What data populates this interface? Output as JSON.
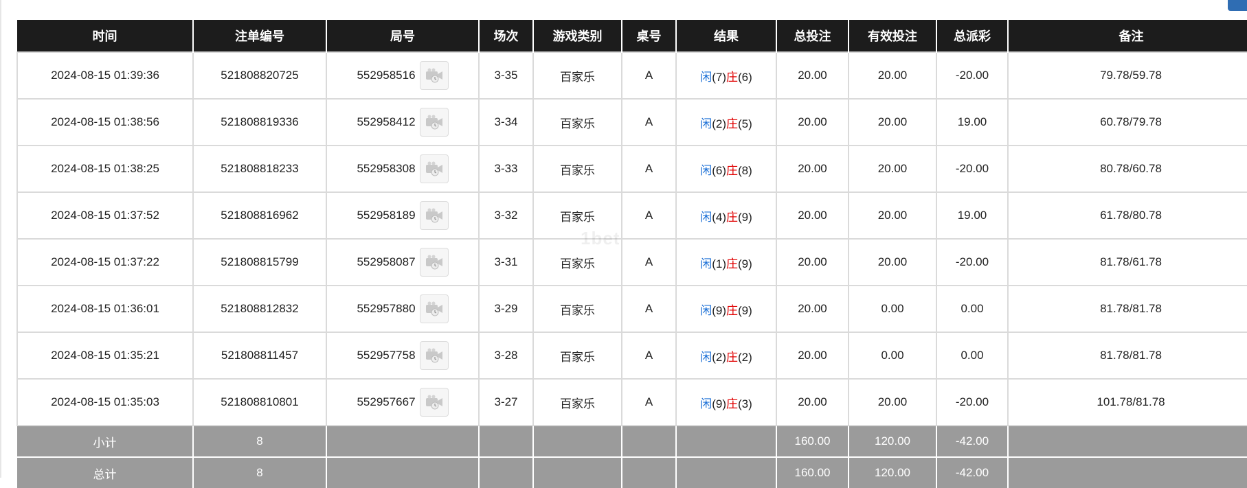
{
  "headers": [
    "时间",
    "注单编号",
    "局号",
    "场次",
    "游戏类别",
    "桌号",
    "结果",
    "总投注",
    "有效投注",
    "总派彩",
    "备注"
  ],
  "result_labels": {
    "player": "闲",
    "banker": "庄"
  },
  "rows": [
    {
      "time": "2024-08-15 01:39:36",
      "bet_id": "521808820725",
      "round": "552958516",
      "session": "3-35",
      "game": "百家乐",
      "table": "A",
      "player": "(7)",
      "banker": "(6)",
      "total_bet": "20.00",
      "valid_bet": "20.00",
      "payout": "-20.00",
      "note": "79.78/59.78"
    },
    {
      "time": "2024-08-15 01:38:56",
      "bet_id": "521808819336",
      "round": "552958412",
      "session": "3-34",
      "game": "百家乐",
      "table": "A",
      "player": "(2)",
      "banker": "(5)",
      "total_bet": "20.00",
      "valid_bet": "20.00",
      "payout": "19.00",
      "note": "60.78/79.78"
    },
    {
      "time": "2024-08-15 01:38:25",
      "bet_id": "521808818233",
      "round": "552958308",
      "session": "3-33",
      "game": "百家乐",
      "table": "A",
      "player": "(6)",
      "banker": "(8)",
      "total_bet": "20.00",
      "valid_bet": "20.00",
      "payout": "-20.00",
      "note": "80.78/60.78"
    },
    {
      "time": "2024-08-15 01:37:52",
      "bet_id": "521808816962",
      "round": "552958189",
      "session": "3-32",
      "game": "百家乐",
      "table": "A",
      "player": "(4)",
      "banker": "(9)",
      "total_bet": "20.00",
      "valid_bet": "20.00",
      "payout": "19.00",
      "note": "61.78/80.78"
    },
    {
      "time": "2024-08-15 01:37:22",
      "bet_id": "521808815799",
      "round": "552958087",
      "session": "3-31",
      "game": "百家乐",
      "table": "A",
      "player": "(1)",
      "banker": "(9)",
      "total_bet": "20.00",
      "valid_bet": "20.00",
      "payout": "-20.00",
      "note": "81.78/61.78"
    },
    {
      "time": "2024-08-15 01:36:01",
      "bet_id": "521808812832",
      "round": "552957880",
      "session": "3-29",
      "game": "百家乐",
      "table": "A",
      "player": "(9)",
      "banker": "(9)",
      "total_bet": "20.00",
      "valid_bet": "0.00",
      "payout": "0.00",
      "note": "81.78/81.78"
    },
    {
      "time": "2024-08-15 01:35:21",
      "bet_id": "521808811457",
      "round": "552957758",
      "session": "3-28",
      "game": "百家乐",
      "table": "A",
      "player": "(2)",
      "banker": "(2)",
      "total_bet": "20.00",
      "valid_bet": "0.00",
      "payout": "0.00",
      "note": "81.78/81.78"
    },
    {
      "time": "2024-08-15 01:35:03",
      "bet_id": "521808810801",
      "round": "552957667",
      "session": "3-27",
      "game": "百家乐",
      "table": "A",
      "player": "(9)",
      "banker": "(3)",
      "total_bet": "20.00",
      "valid_bet": "20.00",
      "payout": "-20.00",
      "note": "101.78/81.78"
    }
  ],
  "subtotal": {
    "label": "小计",
    "count": "8",
    "total_bet": "160.00",
    "valid_bet": "120.00",
    "payout": "-42.00"
  },
  "grandtotal": {
    "label": "总计",
    "count": "8",
    "total_bet": "160.00",
    "valid_bet": "120.00",
    "payout": "-42.00"
  },
  "watermark": "1bet",
  "colors": {
    "header_bg": "#1c1c1c",
    "total_bg": "#9b9b9b",
    "positive_blue": "#1a6fd6",
    "negative_red": "#e00000",
    "accent": "#2f6db3"
  },
  "icons": {
    "replay": "video-replay-icon"
  }
}
